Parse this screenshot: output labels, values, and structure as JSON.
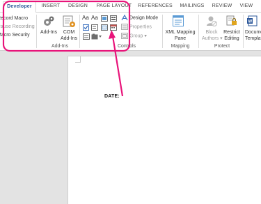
{
  "tabs": [
    {
      "label": "Developer",
      "active": true
    },
    {
      "label": "INSERT"
    },
    {
      "label": "DESIGN"
    },
    {
      "label": "PAGE LAYOUT"
    },
    {
      "label": "REFERENCES"
    },
    {
      "label": "MAILINGS"
    },
    {
      "label": "REVIEW"
    },
    {
      "label": "VIEW"
    }
  ],
  "code": {
    "record_macro": "Record Macro",
    "pause_recording": "Pause Recording",
    "macro_security": "Macro Security"
  },
  "addins": {
    "addins_label": "Add-Ins",
    "com_line1": "COM",
    "com_line2": "Add-Ins",
    "group_label": "Add-Ins"
  },
  "controls": {
    "design_mode": "Design Mode",
    "properties": "Properties",
    "group": "Group",
    "group_label": "Controls"
  },
  "mapping": {
    "xml_line1": "XML Mapping",
    "xml_line2": "Pane",
    "group_label": "Mapping"
  },
  "protect": {
    "block_line1": "Block",
    "block_line2": "Authors",
    "restrict_line1": "Restrict",
    "restrict_line2": "Editing",
    "group_label": "Protect"
  },
  "templates": {
    "doc_line1": "Document",
    "doc_line2": "Template"
  },
  "document": {
    "date_label": "DATE:"
  },
  "colors": {
    "accent": "#2b579a",
    "annotation": "#e8147a"
  }
}
